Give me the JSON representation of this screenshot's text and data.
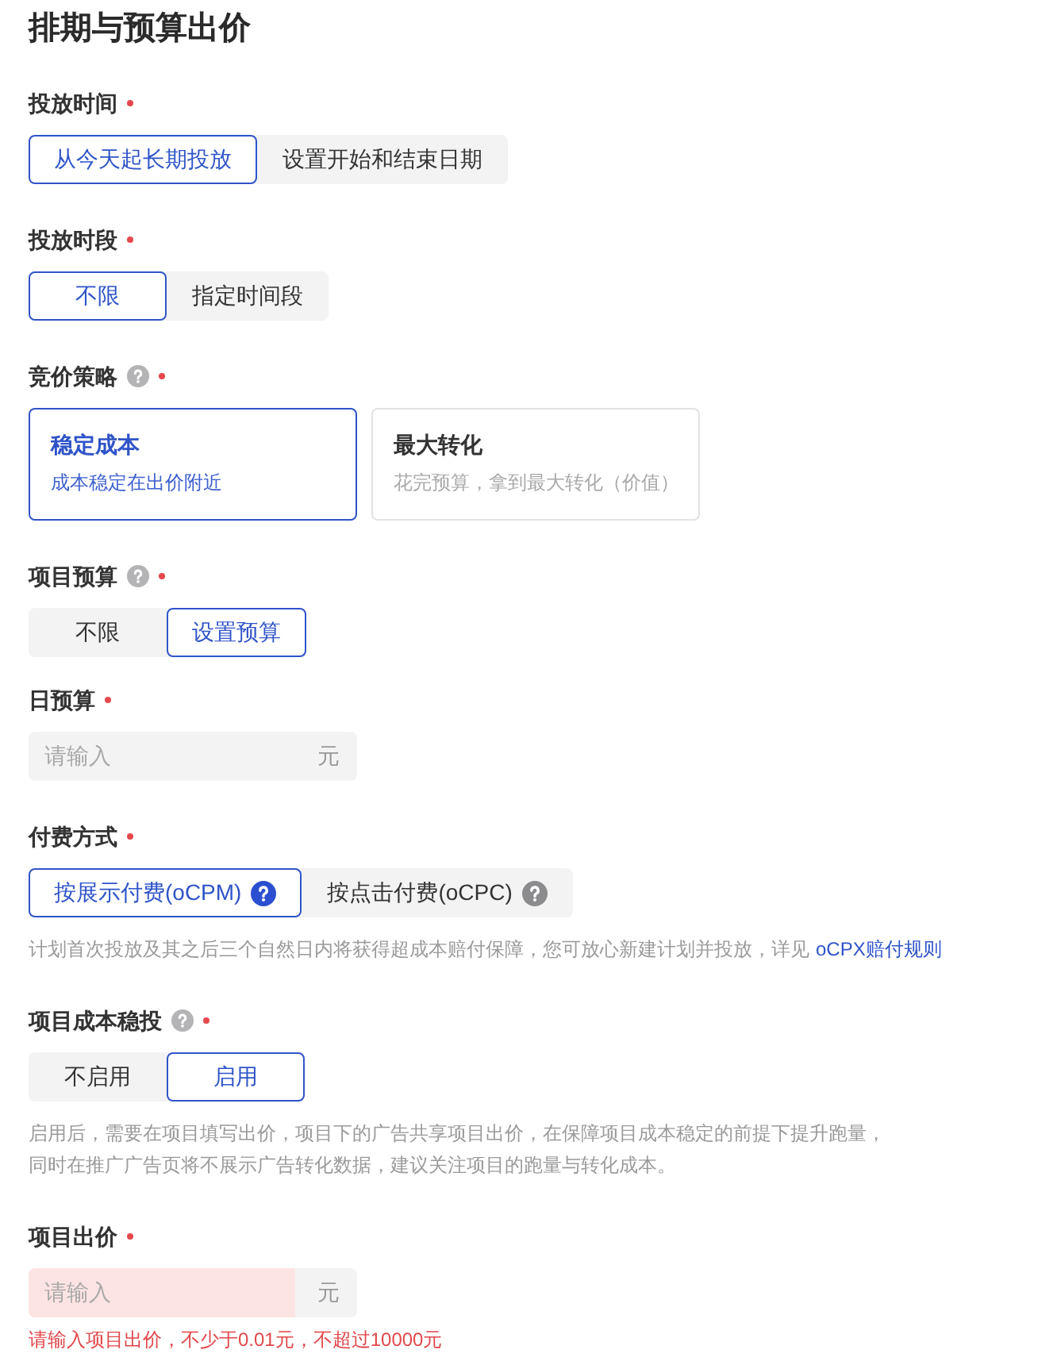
{
  "title": "排期与预算出价",
  "fields": [
    {
      "kind": "segmented",
      "label": "投放时间",
      "required": true,
      "options": [
        {
          "label": "从今天起长期投放",
          "selected": true
        },
        {
          "label": "设置开始和结束日期",
          "selected": false
        }
      ]
    },
    {
      "kind": "segmented",
      "label": "投放时段",
      "required": true,
      "options": [
        {
          "label": "不限",
          "selected": true
        },
        {
          "label": "指定时间段",
          "selected": false
        }
      ]
    },
    {
      "kind": "cards",
      "label": "竞价策略",
      "required": true,
      "help": true,
      "options": [
        {
          "title": "稳定成本",
          "description": "成本稳定在出价附近",
          "selected": true
        },
        {
          "title": "最大转化",
          "description": "花完预算，拿到最大转化（价值）",
          "selected": false
        }
      ]
    },
    {
      "kind": "segmented",
      "label": "项目预算",
      "required": true,
      "help": true,
      "options": [
        {
          "label": "不限",
          "selected": false
        },
        {
          "label": "设置预算",
          "selected": true
        }
      ],
      "children": [
        {
          "kind": "input",
          "label": "日预算",
          "required": true,
          "placeholder": "请输入",
          "unit": "元",
          "invalid": false
        }
      ]
    },
    {
      "kind": "segmented",
      "label": "付费方式",
      "required": true,
      "options": [
        {
          "label": "按展示付费(oCPM)",
          "help": true,
          "selected": true
        },
        {
          "label": "按点击付费(oCPC)",
          "help": true,
          "selected": false
        }
      ],
      "note": {
        "lines": [
          "计划首次投放及其之后三个自然日内将获得超成本赔付保障，您可放心新建计划并投放，详见"
        ],
        "link": "oCPX赔付规则"
      }
    },
    {
      "kind": "segmented",
      "label": "项目成本稳投",
      "required": true,
      "help": true,
      "options": [
        {
          "label": "不启用",
          "selected": false
        },
        {
          "label": "启用",
          "selected": true
        }
      ],
      "note": {
        "lines": [
          "启用后，需要在项目填写出价，项目下的广告共享项目出价，在保障项目成本稳定的前提下提升跑量，",
          "同时在推广广告页将不展示广告转化数据，建议关注项目的跑量与转化成本。"
        ]
      }
    },
    {
      "kind": "input",
      "label": "项目出价",
      "required": true,
      "placeholder": "请输入",
      "unit": "元",
      "invalid": true,
      "message": "请输入项目出价，不少于0.01元，不超过10000元"
    }
  ]
}
